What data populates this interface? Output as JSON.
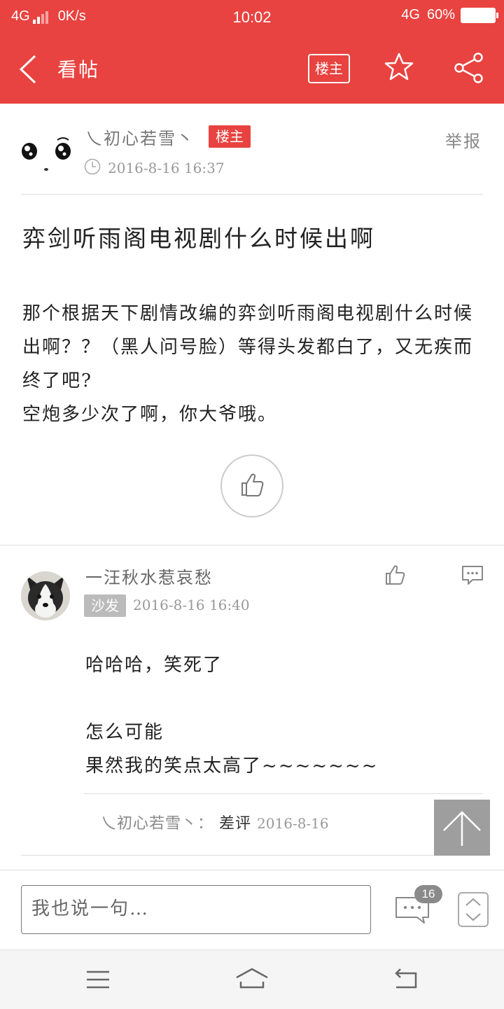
{
  "status_bar": {
    "network": "4G",
    "speed": "0K/s",
    "time": "10:02",
    "network_right": "4G",
    "battery": "60%"
  },
  "header": {
    "title": "看帖",
    "owner_button": "楼主",
    "icons": [
      "back-icon",
      "star-icon",
      "share-icon"
    ]
  },
  "post": {
    "author": "乀初心若雪丶",
    "author_tag": "楼主",
    "report": "举报",
    "time": "2016-8-16 16:37",
    "title": "弈剑听雨阁电视剧什么时候出啊",
    "body": "那个根据天下剧情改编的弈剑听雨阁电视剧什么时候出啊？？（黑人问号脸）等得头发都白了，又无疾而终了吧?\n空炮多少次了啊，你大爷哦。"
  },
  "reply": {
    "author": "一汪秋水惹哀愁",
    "floor": "沙发",
    "time": "2016-8-16 16:40",
    "body": "哈哈哈，笑死了\n\n怎么可能\n果然我的笑点太高了~~~~~~~",
    "sub_reply": {
      "author": "乀初心若雪丶：",
      "text": "差评",
      "time": "2016-8-16"
    }
  },
  "bottom_bar": {
    "placeholder": "我也说一句…",
    "comment_count": "16"
  },
  "colors": {
    "brand": "#e84340",
    "badge_gray": "#bbbbbb"
  }
}
